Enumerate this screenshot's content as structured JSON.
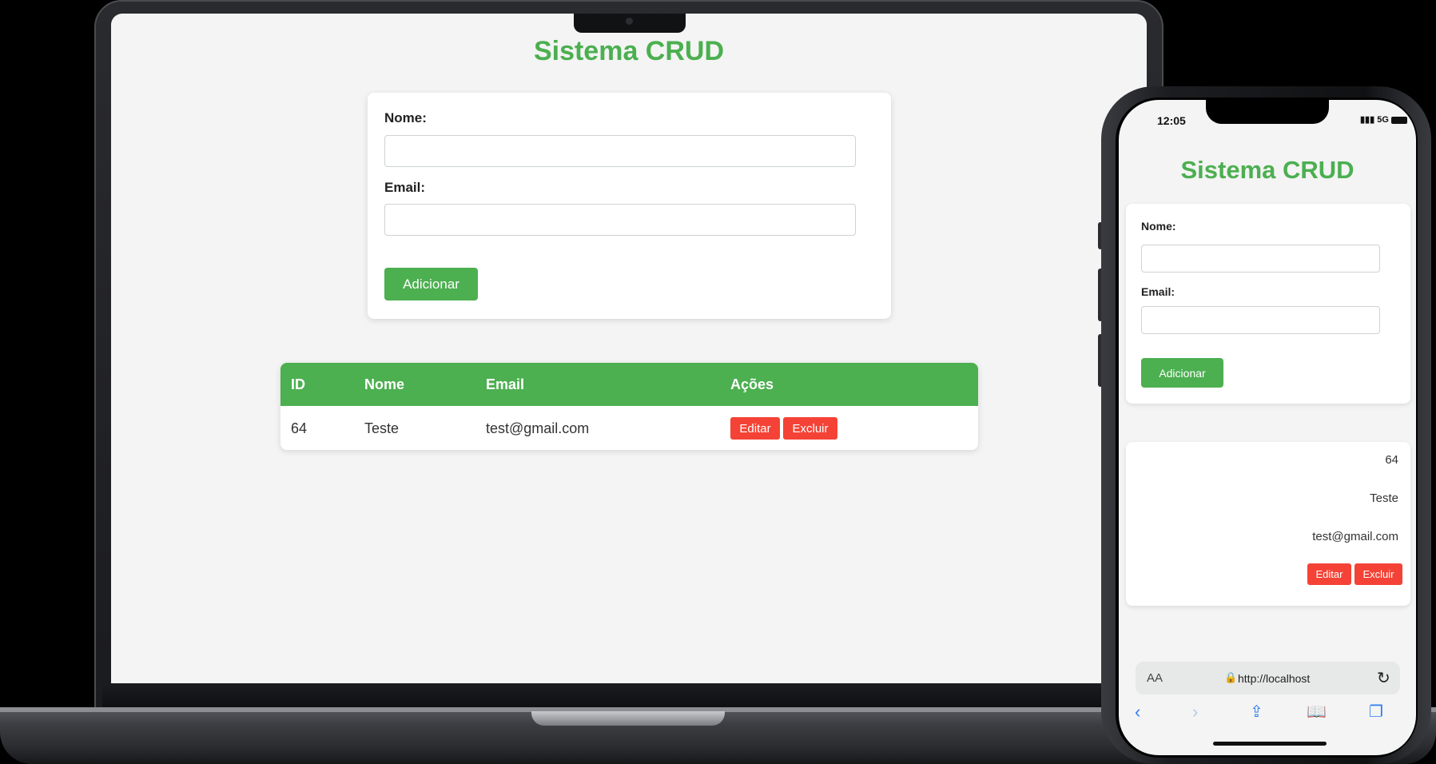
{
  "app": {
    "title": "Sistema CRUD",
    "accent_color": "#4caf50",
    "danger_color": "#f44336"
  },
  "form": {
    "name_label": "Nome:",
    "name_value": "",
    "email_label": "Email:",
    "email_value": "",
    "add_button": "Adicionar"
  },
  "table": {
    "headers": [
      "ID",
      "Nome",
      "Email",
      "Ações"
    ],
    "rows": [
      {
        "id": "64",
        "nome": "Teste",
        "email": "test@gmail.com",
        "edit_label": "Editar",
        "delete_label": "Excluir"
      }
    ]
  },
  "phone": {
    "status_time": "12:05",
    "network": "5G",
    "text_size_label": "AA",
    "url": "http://localhost"
  },
  "icons": {
    "lock": "lock-icon",
    "reload": "reload-icon",
    "back": "chevron-left-icon",
    "forward": "chevron-right-icon",
    "share": "share-icon",
    "bookmarks": "book-icon",
    "tabs": "tabs-icon"
  }
}
